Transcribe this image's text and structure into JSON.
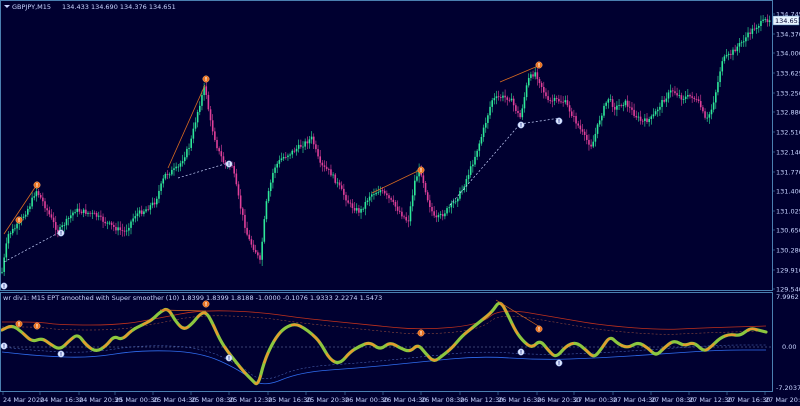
{
  "main_header": {
    "symbol": "GBPJPY,M15",
    "ohlc": "134.433 134.690 134.376 134.651"
  },
  "current_price": "134.651",
  "price_axis": [
    "134.745",
    "134.370",
    "134.000",
    "133.625",
    "133.250",
    "132.880",
    "132.510",
    "132.140",
    "131.770",
    "131.400",
    "131.025",
    "130.650",
    "130.280",
    "129.910",
    "129.540"
  ],
  "indicator_header": "wr div1: M15 EPT smoothed with Super smoother (10) 1.8399 1.8399 1.8188 -1.0000 -0.1076 1.9333 2.2274 1.5473",
  "indicator_axis": [
    "7.9962",
    "0.00",
    "-7.2037"
  ],
  "time_axis": [
    "24 Mar 2020",
    "24 Mar 16:30",
    "24 Mar 20:30",
    "25 Mar 00:30",
    "25 Mar 04:30",
    "25 Mar 08:30",
    "25 Mar 12:30",
    "25 Mar 16:30",
    "25 Mar 20:30",
    "26 Mar 00:30",
    "26 Mar 04:30",
    "26 Mar 08:30",
    "26 Mar 12:30",
    "26 Mar 16:30",
    "26 Mar 20:30",
    "27 Mar 00:30",
    "27 Mar 04:30",
    "27 Mar 08:30",
    "27 Mar 12:30",
    "27 Mar 16:30",
    "27 Mar 20:30"
  ],
  "colors": {
    "background": "#000030",
    "bull": "#2ee89a",
    "bear": "#e0409a",
    "grid_border": "#4a7fb0",
    "osc_green": "#8cc63f",
    "osc_orange": "#e69a2e",
    "band_red": "#c0311c",
    "band_blue": "#2f6cf0",
    "divergence_line": "#d86a20"
  },
  "signals": {
    "bearish_icon": "orange-divergence-marker",
    "bullish_icon": "white-divergence-marker"
  }
}
